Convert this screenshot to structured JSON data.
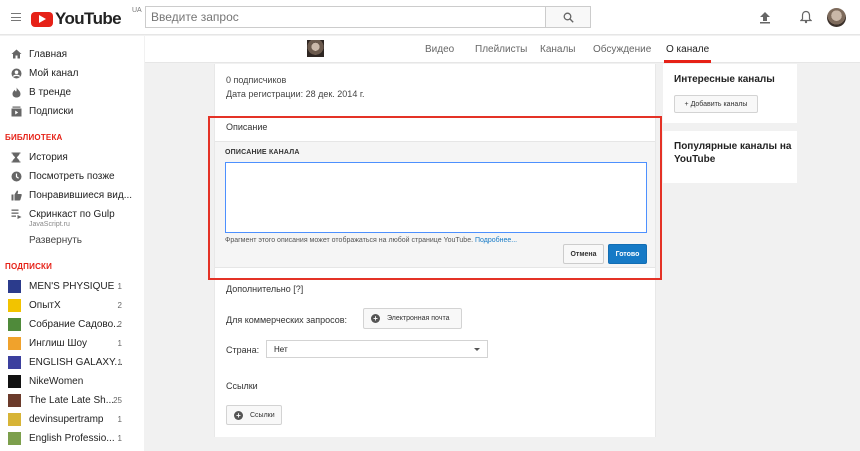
{
  "header": {
    "logo_text": "YouTube",
    "logo_region": "UA",
    "search_placeholder": "Введите запрос"
  },
  "sidebar": {
    "nav": [
      {
        "label": "Главная",
        "icon": "home-icon"
      },
      {
        "label": "Мой канал",
        "icon": "account-icon"
      },
      {
        "label": "В тренде",
        "icon": "flame-icon"
      },
      {
        "label": "Подписки",
        "icon": "subscriptions-icon"
      }
    ],
    "library_heading": "БИБЛИОТЕКА",
    "library": [
      {
        "label": "История",
        "icon": "history-icon"
      },
      {
        "label": "Посмотреть позже",
        "icon": "clock-icon"
      },
      {
        "label": "Понравившиеся вид...",
        "icon": "thumbs-up-icon"
      },
      {
        "label": "Скринкаст по Gulp",
        "sub": "JavaScript.ru",
        "icon": "playlist-icon"
      }
    ],
    "expand_label": "Развернуть",
    "subs_heading": "ПОДПИСКИ",
    "subscriptions": [
      {
        "label": "MEN'S PHYSIQUE",
        "count": "1",
        "color": "#2b3b8c"
      },
      {
        "label": "ОпытX",
        "count": "2",
        "color": "#f2c300"
      },
      {
        "label": "Собрание Садово...",
        "count": "2",
        "color": "#4f8a3a"
      },
      {
        "label": "Инглиш Шоу",
        "count": "1",
        "color": "#f0a22c"
      },
      {
        "label": "ENGLISH GALAXY...",
        "count": "1",
        "color": "#3b3f9e"
      },
      {
        "label": "NikeWomen",
        "count": "",
        "color": "#111111"
      },
      {
        "label": "The Late Late Sh...",
        "count": "25",
        "color": "#6b3b2b"
      },
      {
        "label": "devinsupertramp",
        "count": "1",
        "color": "#d7b437"
      },
      {
        "label": "English Professio...",
        "count": "1",
        "color": "#7c9f4c"
      }
    ]
  },
  "channel_tabs": {
    "items": [
      "Видео",
      "Плейлисты",
      "Каналы",
      "Обсуждение",
      "О канале"
    ],
    "active_index": 4
  },
  "about": {
    "subscribers": "0 подписчиков",
    "registered": "Дата регистрации: 28 дек. 2014 г.",
    "description_title": "Описание",
    "description_heading": "ОПИСАНИЕ КАНАЛА",
    "description_value": "",
    "description_hint": "Фрагмент этого описания может отображаться на любой странице YouTube.",
    "description_more": "Подробнее...",
    "cancel_label": "Отмена",
    "done_label": "Готово",
    "additional_title": "Дополнительно [?]",
    "business_label": "Для коммерческих запросов:",
    "email_button": "Электронная почта",
    "country_label": "Страна:",
    "country_value": "Нет",
    "links_title": "Ссылки",
    "links_button": "Ссылки"
  },
  "right": {
    "interesting_title": "Интересные каналы",
    "add_channels_button": "+ Добавить каналы",
    "popular_title": "Популярные каналы на YouTube"
  },
  "colors": {
    "accent_red": "#e62117",
    "link_blue": "#167ac6",
    "highlight": "#e43226"
  }
}
